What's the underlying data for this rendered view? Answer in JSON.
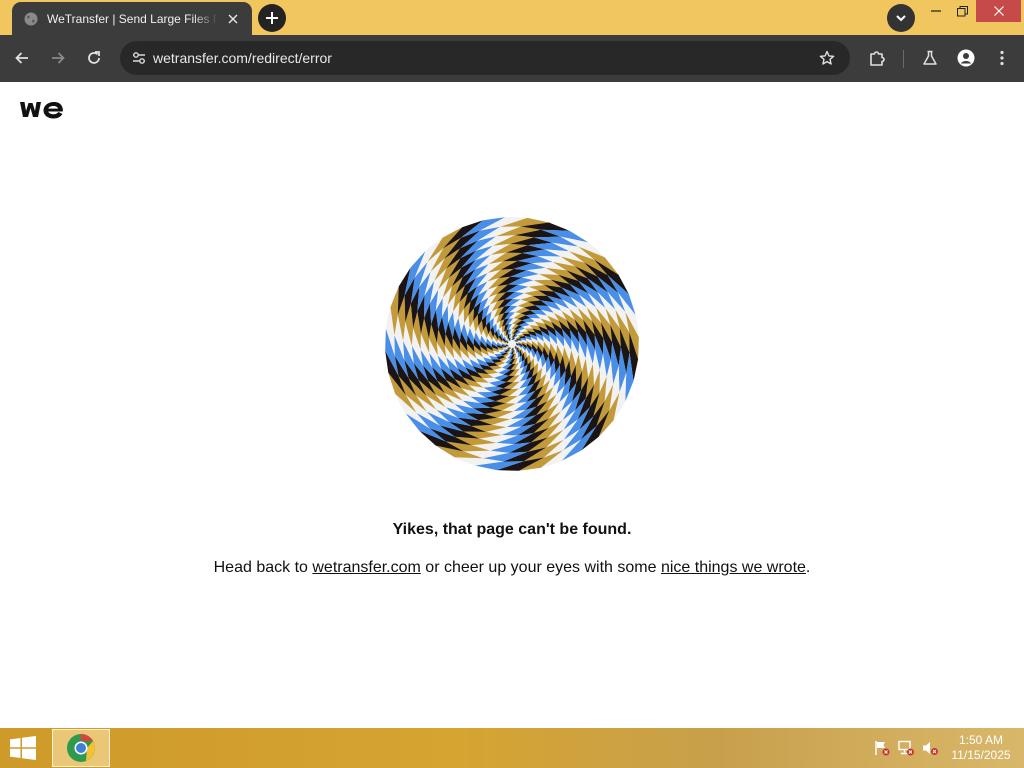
{
  "browser": {
    "tab": {
      "title": "WeTransfer | Send Large Files Fast",
      "favicon": "globe-icon"
    },
    "address_bar": {
      "url": "wetransfer.com/redirect/error"
    },
    "colors": {
      "frame": "#f1c65f",
      "toolbar": "#3c3c3c",
      "close_button": "#c74a4a"
    }
  },
  "page": {
    "logo": "wetransfer-logo",
    "illustration": "spiral-illusion",
    "heading": "Yikes, that page can't be found.",
    "message": {
      "before": "Head back to ",
      "link1": "wetransfer.com",
      "middle": " or cheer up your eyes with some ",
      "link2": "nice things we wrote",
      "after": "."
    },
    "spiral_colors": [
      "#4a8fe7",
      "#f2f2f2",
      "#c29a3a",
      "#1a1414"
    ]
  },
  "taskbar": {
    "clock": {
      "time": "1:50 AM",
      "date": "11/15/2025"
    },
    "tray_icons": [
      "action-center-flag-icon",
      "network-icon",
      "volume-muted-icon"
    ]
  }
}
